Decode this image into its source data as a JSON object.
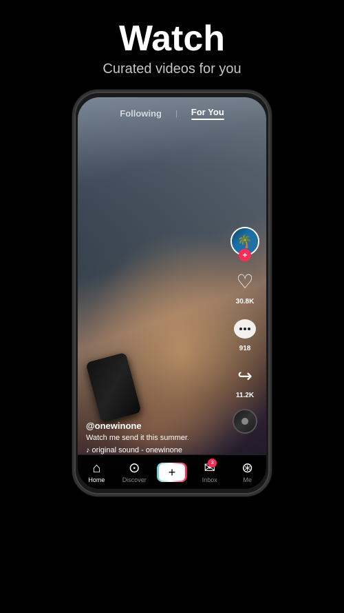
{
  "page": {
    "background": "#000000"
  },
  "header": {
    "title": "Watch",
    "subtitle": "Curated videos for you"
  },
  "phone": {
    "nav": {
      "following_label": "Following",
      "foryou_label": "For You",
      "divider": "|"
    },
    "video": {
      "username": "@onewinone",
      "description": "Watch me send it this summer.",
      "music": "♪  original sound - onewinone"
    },
    "actions": {
      "likes_count": "30.8K",
      "comments_count": "918",
      "shares_count": "11.2K"
    },
    "bottom_nav": {
      "home_label": "Home",
      "discover_label": "Discover",
      "plus_label": "+",
      "inbox_label": "Inbox",
      "inbox_badge": "3",
      "me_label": "Me"
    }
  }
}
